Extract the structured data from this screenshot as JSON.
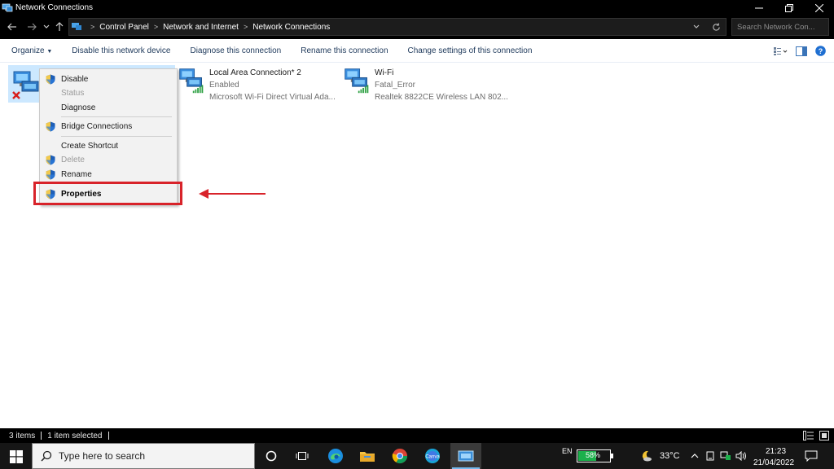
{
  "window": {
    "title": "Network Connections"
  },
  "address": {
    "crumbs": [
      "Control Panel",
      "Network and Internet",
      "Network Connections"
    ],
    "search_placeholder": "Search Network Con..."
  },
  "toolbar": {
    "organize": "Organize",
    "disable": "Disable this network device",
    "diagnose": "Diagnose this connection",
    "rename": "Rename this connection",
    "change": "Change settings of this connection"
  },
  "connections": [
    {
      "name": "Local Area Connection* 2",
      "status": "Enabled",
      "device": "Microsoft Wi-Fi Direct Virtual Ada..."
    },
    {
      "name": "Wi-Fi",
      "status": "Fatal_Error",
      "device": "Realtek 8822CE Wireless LAN 802..."
    }
  ],
  "context_menu": {
    "items": [
      {
        "label": "Disable",
        "enabled": true,
        "shield": true
      },
      {
        "label": "Status",
        "enabled": false,
        "shield": false
      },
      {
        "label": "Diagnose",
        "enabled": true,
        "shield": false
      },
      {
        "label": "Bridge Connections",
        "enabled": true,
        "shield": true
      },
      {
        "label": "Create Shortcut",
        "enabled": true,
        "shield": false
      },
      {
        "label": "Delete",
        "enabled": false,
        "shield": true
      },
      {
        "label": "Rename",
        "enabled": true,
        "shield": true
      },
      {
        "label": "Properties",
        "enabled": true,
        "shield": true,
        "bold": true
      }
    ]
  },
  "statusbar": {
    "items": "3 items",
    "selected": "1 item selected"
  },
  "taskbar": {
    "search_placeholder": "Type here to search",
    "language": "EN",
    "battery": {
      "label": "58%",
      "level": 0.58
    },
    "temperature": "33°C",
    "time": "21:23",
    "date": "21/04/2022"
  },
  "colors": {
    "highlight": "#d8232a",
    "battery": "#1bb04b",
    "link": "#1e395b"
  }
}
